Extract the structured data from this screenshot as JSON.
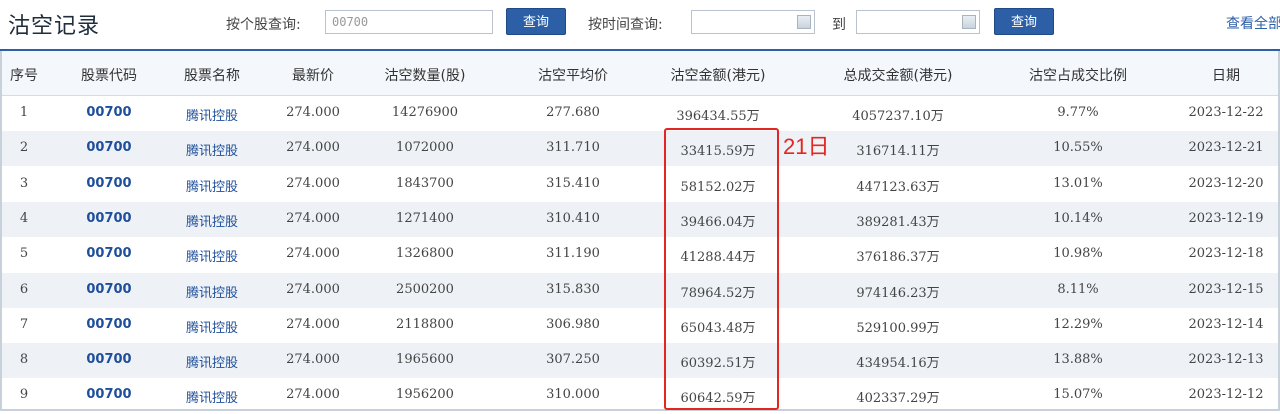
{
  "title": "沽空记录",
  "search": {
    "stock_label": "按个股查询:",
    "stock_value": "00700",
    "query_button": "查询",
    "time_label": "按时间查询:",
    "to_label": "到",
    "query_button2": "查询",
    "view_all": "查看全部"
  },
  "table": {
    "headers": [
      "序号",
      "股票代码",
      "股票名称",
      "最新价",
      "沽空数量(股)",
      "沽空平均价",
      "沽空金额(港元)",
      "总成交金额(港元)",
      "沽空占成交比例",
      "日期"
    ],
    "rows": [
      [
        "1",
        "00700",
        "腾讯控股",
        "274.000",
        "14276900",
        "277.680",
        "396434.55万",
        "4057237.10万",
        "9.77%",
        "2023-12-22"
      ],
      [
        "2",
        "00700",
        "腾讯控股",
        "274.000",
        "1072000",
        "311.710",
        "33415.59万",
        "316714.11万",
        "10.55%",
        "2023-12-21"
      ],
      [
        "3",
        "00700",
        "腾讯控股",
        "274.000",
        "1843700",
        "315.410",
        "58152.02万",
        "447123.63万",
        "13.01%",
        "2023-12-20"
      ],
      [
        "4",
        "00700",
        "腾讯控股",
        "274.000",
        "1271400",
        "310.410",
        "39466.04万",
        "389281.43万",
        "10.14%",
        "2023-12-19"
      ],
      [
        "5",
        "00700",
        "腾讯控股",
        "274.000",
        "1326800",
        "311.190",
        "41288.44万",
        "376186.37万",
        "10.98%",
        "2023-12-18"
      ],
      [
        "6",
        "00700",
        "腾讯控股",
        "274.000",
        "2500200",
        "315.830",
        "78964.52万",
        "974146.23万",
        "8.11%",
        "2023-12-15"
      ],
      [
        "7",
        "00700",
        "腾讯控股",
        "274.000",
        "2118800",
        "306.980",
        "65043.48万",
        "529100.99万",
        "12.29%",
        "2023-12-14"
      ],
      [
        "8",
        "00700",
        "腾讯控股",
        "274.000",
        "1965600",
        "307.250",
        "60392.51万",
        "434954.16万",
        "13.88%",
        "2023-12-13"
      ],
      [
        "9",
        "00700",
        "腾讯控股",
        "274.000",
        "1956200",
        "310.000",
        "60642.59万",
        "402337.29万",
        "15.07%",
        "2023-12-12"
      ]
    ]
  },
  "annotation": {
    "note": "21日",
    "color": "#e3261f"
  }
}
